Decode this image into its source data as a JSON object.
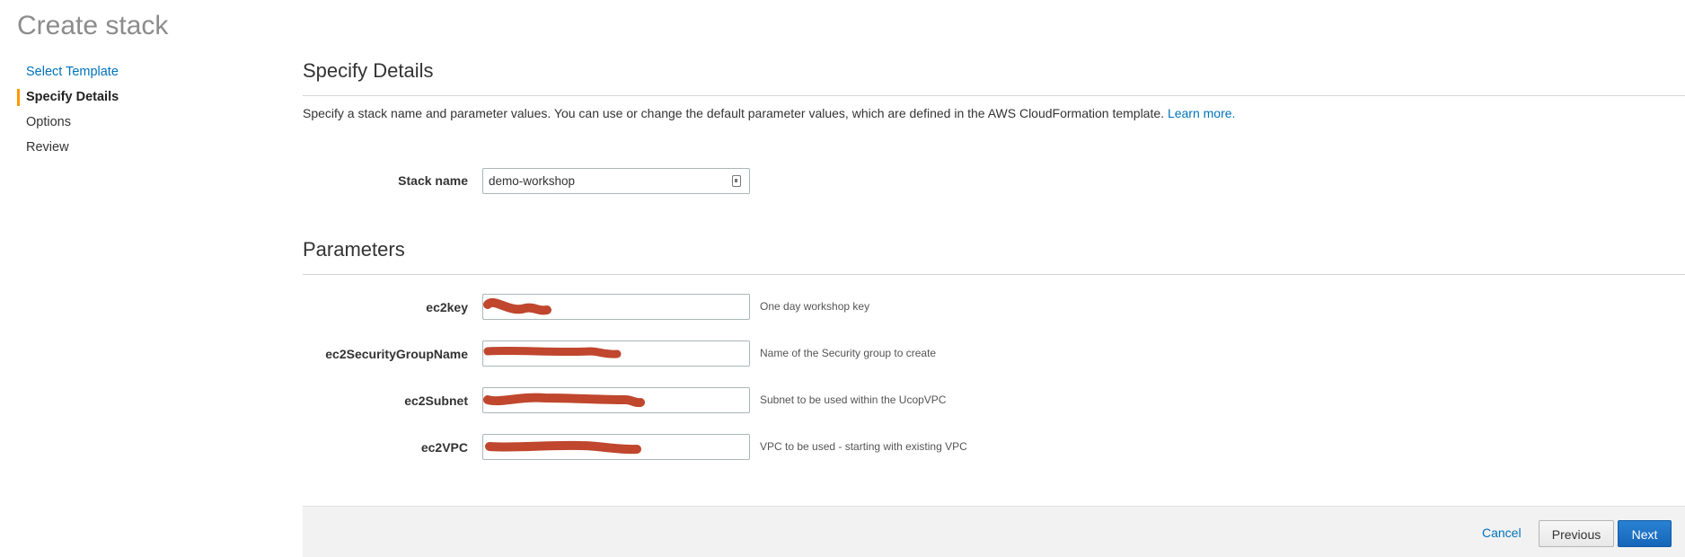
{
  "page": {
    "title": "Create stack"
  },
  "steps": [
    {
      "label": "Select Template",
      "state": "link"
    },
    {
      "label": "Specify Details",
      "state": "active"
    },
    {
      "label": "Options",
      "state": "pending"
    },
    {
      "label": "Review",
      "state": "pending"
    }
  ],
  "details": {
    "title": "Specify Details",
    "description": "Specify a stack name and parameter values. You can use or change the default parameter values, which are defined in the AWS CloudFormation template.",
    "learn_more": "Learn more.",
    "stack_name_label": "Stack name",
    "stack_name_value": "demo-workshop"
  },
  "parameters": {
    "title": "Parameters",
    "rows": [
      {
        "label": "ec2key",
        "hint": "One day workshop key"
      },
      {
        "label": "ec2SecurityGroupName",
        "hint": "Name of the Security group to create"
      },
      {
        "label": "ec2Subnet",
        "hint": "Subnet to be used within the UcopVPC"
      },
      {
        "label": "ec2VPC",
        "hint": "VPC to be used - starting with existing VPC"
      }
    ]
  },
  "footer": {
    "cancel": "Cancel",
    "previous": "Previous",
    "next": "Next"
  },
  "colors": {
    "accent_orange": "#ff9900",
    "link_blue": "#0073bb",
    "primary_button": "#1565b9",
    "redaction": "#c0462e"
  },
  "icons": {
    "input_autofill": "contact-card-icon"
  }
}
